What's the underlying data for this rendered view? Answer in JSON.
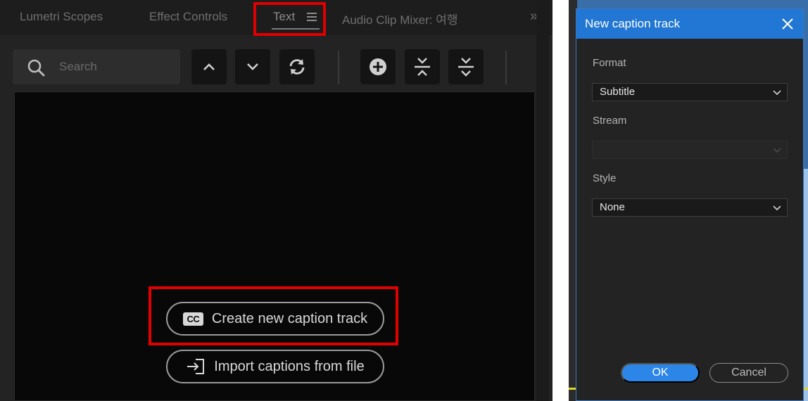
{
  "left_panel": {
    "tabs": [
      {
        "label": "Lumetri Scopes"
      },
      {
        "label": "Effect Controls"
      },
      {
        "label": "Text"
      },
      {
        "label": "Audio Clip Mixer: 여행"
      }
    ],
    "overflow_glyph": "»",
    "search": {
      "placeholder": "Search"
    },
    "toolbar_icons": [
      "chevron-up-icon",
      "chevron-down-icon",
      "refresh-icon",
      "plus-circle-icon",
      "merge-icon",
      "split-icon"
    ],
    "buttons": {
      "create_caption_track": "Create new caption track",
      "cc_badge": "CC",
      "import_captions": "Import captions from file"
    }
  },
  "dialog": {
    "title": "New caption track",
    "format": {
      "label": "Format",
      "value": "Subtitle"
    },
    "stream": {
      "label": "Stream",
      "value": ""
    },
    "style": {
      "label": "Style",
      "value": "None"
    },
    "ok_label": "OK",
    "cancel_label": "Cancel"
  },
  "colors": {
    "highlight": "#e00000",
    "accent": "#2177d3",
    "ok_button": "#2b86e8"
  }
}
